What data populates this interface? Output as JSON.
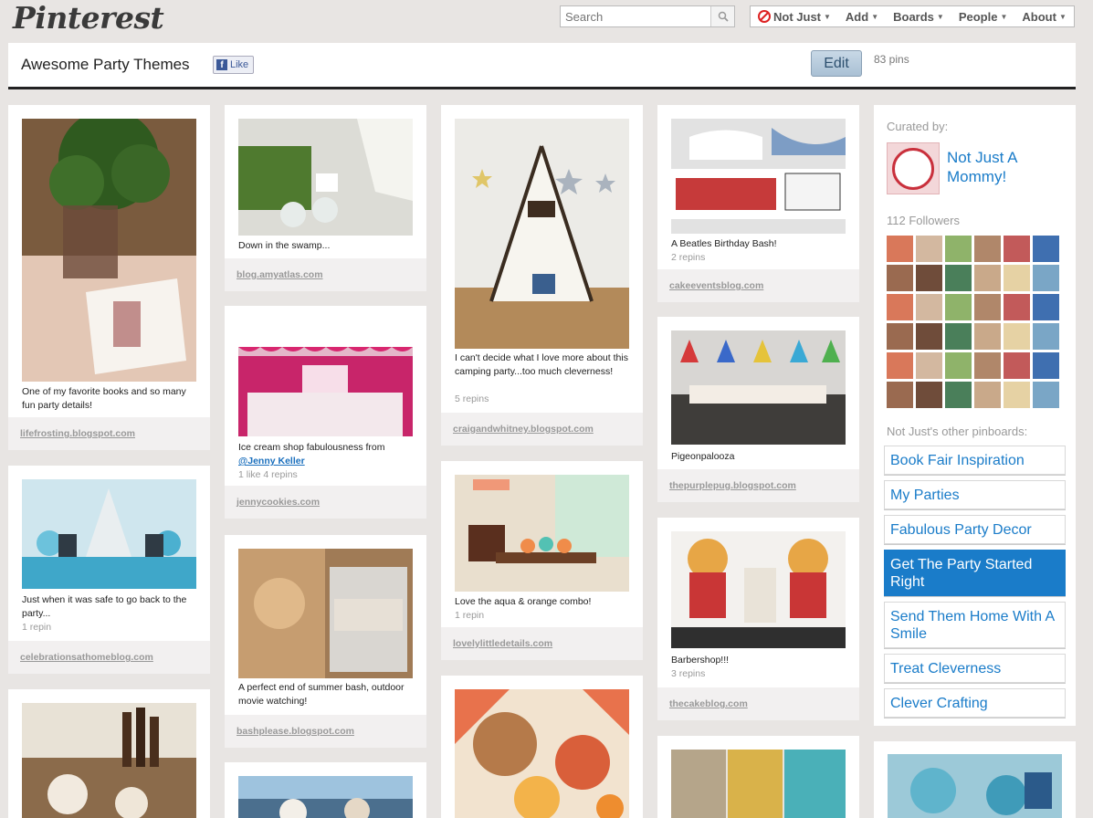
{
  "header": {
    "logo": "Pinterest",
    "search_placeholder": "Search",
    "nav": [
      "Not Just",
      "Add",
      "Boards",
      "People",
      "About"
    ]
  },
  "board": {
    "title": "Awesome Party Themes",
    "like_label": "Like",
    "edit_label": "Edit",
    "pin_count": "83 pins"
  },
  "pins": [
    {
      "desc": "One of my favorite books and so many fun party details!",
      "meta": "",
      "source": "lifefrosting.blogspot.com"
    },
    {
      "desc": "Just when it was safe to go back to the party...",
      "meta": "1 repin",
      "source": "celebrationsathomeblog.com"
    },
    {
      "desc": "Down in the swamp...",
      "meta": "",
      "source": "blog.amyatlas.com"
    },
    {
      "desc": "Ice cream shop fabulousness from",
      "mention": "@Jenny Keller",
      "meta": "1 like  4 repins",
      "source": "jennycookies.com"
    },
    {
      "desc": "A perfect end of summer bash, outdoor movie watching!",
      "meta": "",
      "source": "bashplease.blogspot.com"
    },
    {
      "desc": "I can't decide what I love more about this camping party...too much cleverness!",
      "meta": "5 repins",
      "source": "craigandwhitney.blogspot.com"
    },
    {
      "desc": "Love the aqua & orange combo!",
      "meta": "1 repin",
      "source": "lovelylittledetails.com"
    },
    {
      "desc": "A Beatles Birthday Bash!",
      "meta": "2 repins",
      "source": "cakeeventsblog.com"
    },
    {
      "desc": "Pigeonpalooza",
      "meta": "",
      "source": "thepurplepug.blogspot.com"
    },
    {
      "desc": "Barbershop!!!",
      "meta": "3 repins",
      "source": "thecakeblog.com"
    }
  ],
  "sidebar": {
    "curated_label": "Curated by:",
    "user_name": "Not Just A Mommy!",
    "followers": "112 Followers",
    "other_boards_label": "Not Just's other pinboards:",
    "boards": [
      "Book Fair Inspiration",
      "My Parties",
      "Fabulous Party Decor",
      "Get The Party Started Right",
      "Send Them Home With A Smile",
      "Treat Cleverness",
      "Clever Crafting"
    ],
    "active_board_index": 3
  },
  "colors": {
    "accent": "#1a7cc9",
    "background": "#e8e5e3"
  }
}
